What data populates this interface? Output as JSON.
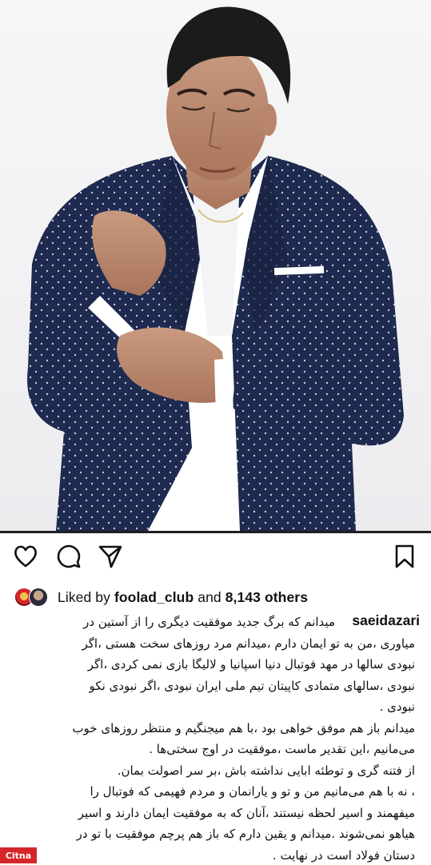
{
  "post": {
    "username": "saeidazari",
    "likes": {
      "prefix": "Liked by",
      "user": "foolad_club",
      "connector": "and",
      "count": "8,143 others"
    },
    "caption_lines": [
      "میدانم که برگ جدید موفقیت دیگری را از آستین در",
      "میاوری ،من به تو ایمان دارم ،میدانم مرد روزهای سخت هستی ،اگر",
      "نبودی سالها در مهد فوتبال دنیا  اسپانیا و لالیگا بازی نمی کردی ،اگر",
      "نبودی ،سالهای متمادی کاپیتان تیم ملی ایران نبودی ،اگر نبودی نکو",
      "نبودی .",
      "میدانم باز هم موفق خواهی بود ،با هم میجنگیم و منتظر روزهای خوب",
      "می‌مانیم ،این تقدیر ماست ،موفقیت در اوج سختی‌ها .",
      "از فتنه گری و توطئه ابایی نداشته باش ،بر سر اصولت بمان.",
      "، نه با هم می‌مانیم من و تو و  یارانمان  و مردم فهیمی که فوتبال را",
      "میفهمند و اسیر لحظه نیستند ،آنان که به موفقیت ایمان دارند و اسیر",
      "هیاهو نمی‌شوند .میدانم و یقین دارم که باز هم پرچم موفقیت با تو در",
      "دستان فولاد است در نهایت ."
    ]
  },
  "watermark": "Citna",
  "colors": {
    "suit": "#1e2a4f",
    "shirt": "#ffffff",
    "accent_red": "#d6262b"
  },
  "icons": [
    "heart-icon",
    "comment-icon",
    "share-icon",
    "bookmark-icon"
  ]
}
